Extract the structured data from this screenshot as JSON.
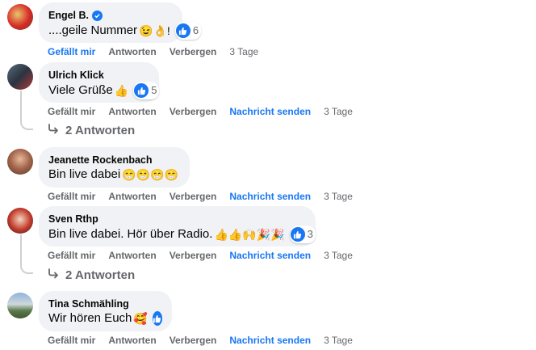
{
  "comments": [
    {
      "author": "Engel B.",
      "verified": true,
      "text": "....geile Nummer",
      "emojis": "😉👌!",
      "reactions": "6",
      "actions": [
        "Gefällt mir",
        "Antworten",
        "Verbergen"
      ],
      "time": "3 Tage"
    },
    {
      "author": "Ulrich Klick",
      "text": "Viele Grüße",
      "emojis": "👍",
      "reactions": "5",
      "actions": [
        "Gefällt mir",
        "Antworten",
        "Verbergen",
        "Nachricht senden"
      ],
      "time": "3 Tage",
      "replies": "2 Antworten"
    },
    {
      "author": "Jeanette Rockenbach",
      "text": "Bin live dabei",
      "emojis": "😁😁😁😁",
      "actions": [
        "Gefällt mir",
        "Antworten",
        "Verbergen",
        "Nachricht senden"
      ],
      "time": "3 Tage"
    },
    {
      "author": "Sven Rthp",
      "text": "Bin live dabei. Hör über Radio.",
      "emojis": "👍👍🙌🎉🎉",
      "reactions": "3",
      "actions": [
        "Gefällt mir",
        "Antworten",
        "Verbergen",
        "Nachricht senden"
      ],
      "time": "3 Tage",
      "replies": "2 Antworten"
    },
    {
      "author": "Tina Schmähling",
      "text": "Wir hören Euch",
      "emojis": "🥰",
      "actions": [
        "Gefällt mir",
        "Antworten",
        "Verbergen",
        "Nachricht senden"
      ],
      "time": "3 Tage"
    }
  ],
  "colors": {
    "link": "#1877f2",
    "muted": "#65676b",
    "bubble": "#f0f2f5"
  },
  "icons": {
    "like": "thumbs-up-icon",
    "reply": "reply-arrow-icon",
    "verified": "verified-badge-icon"
  }
}
